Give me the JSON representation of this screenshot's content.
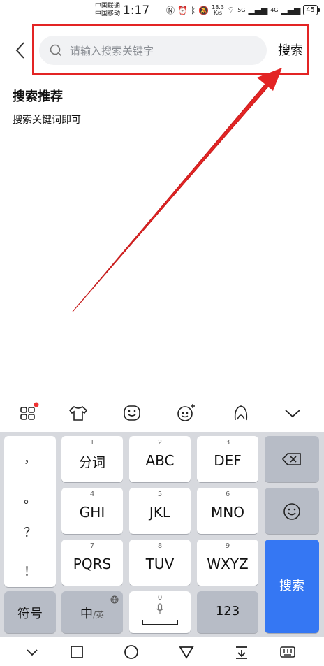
{
  "status": {
    "carrier1": "中国联通",
    "carrier2": "中国移动",
    "time": "1:17",
    "speed_value": "18.3",
    "speed_unit": "K/s",
    "net1": "5G",
    "net2": "4G",
    "battery": "45"
  },
  "search": {
    "placeholder": "请输入搜索关键字",
    "button_label": "搜索"
  },
  "recommend": {
    "title": "搜索推荐",
    "item": "搜索关键词即可"
  },
  "keyboard": {
    "punct": [
      "，",
      "。",
      "？",
      "！"
    ],
    "keys": [
      {
        "num": "1",
        "label": "分词"
      },
      {
        "num": "2",
        "label": "ABC"
      },
      {
        "num": "3",
        "label": "DEF"
      },
      {
        "num": "4",
        "label": "GHI"
      },
      {
        "num": "5",
        "label": "JKL"
      },
      {
        "num": "6",
        "label": "MNO"
      },
      {
        "num": "7",
        "label": "PQRS"
      },
      {
        "num": "8",
        "label": "TUV"
      },
      {
        "num": "9",
        "label": "WXYZ"
      }
    ],
    "symbols": "符号",
    "lang_main": "中",
    "lang_sub": "/英",
    "space_num": "0",
    "num_key": "123",
    "search_key": "搜索"
  },
  "colors": {
    "accent": "#3577f3",
    "highlight": "#e32424"
  },
  "icons": {
    "toolbar": [
      "apps-grid-icon",
      "tshirt-skin-icon",
      "emoji-sticker-icon",
      "face-sticker-icon",
      "handwriting-icon",
      "collapse-keyboard-icon"
    ],
    "nav": [
      "nav-down-icon",
      "nav-recent-icon",
      "nav-home-icon",
      "nav-back-icon",
      "nav-clipboard-icon",
      "nav-keyboard-icon"
    ]
  }
}
